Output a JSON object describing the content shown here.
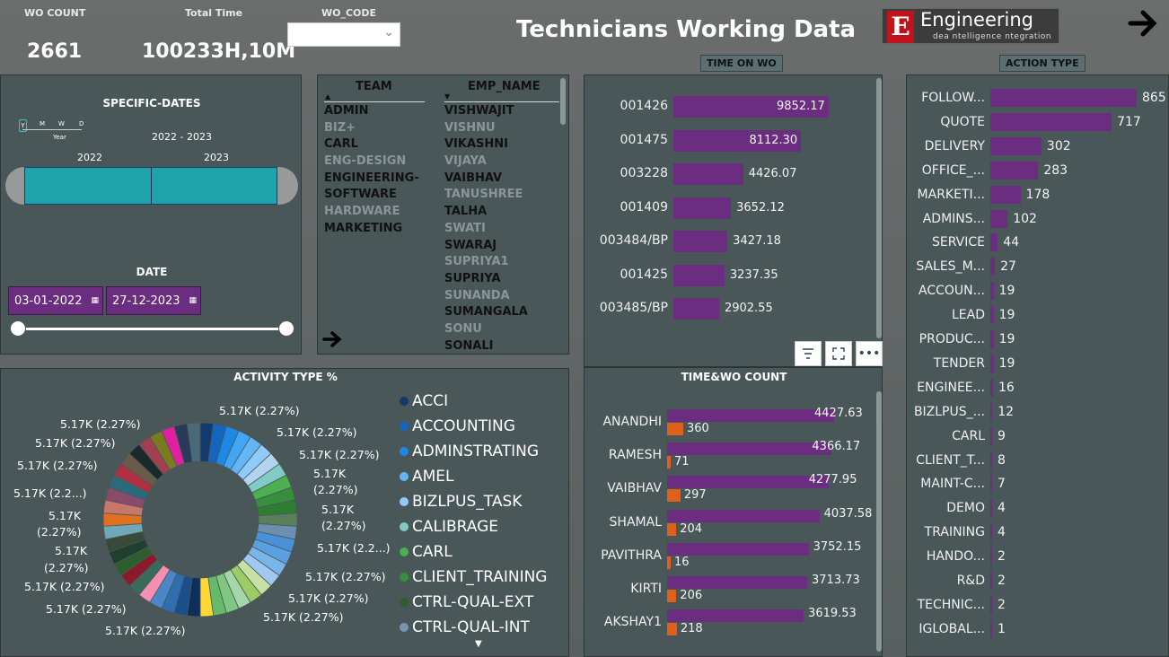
{
  "kpis": {
    "wo_count_label": "WO COUNT",
    "wo_count_value": "2661",
    "total_time_label": "Total Time",
    "total_time_value": "100233H,10M",
    "wo_code_label": "WO_CODE",
    "wo_code_selected": ""
  },
  "header": {
    "title": "Technicians Working Data",
    "logo_text": "Engineering",
    "logo_letter": "E",
    "logo_sub": "dea ntelligence ntegration",
    "next_icon": "arrow-right-icon"
  },
  "dates": {
    "title": "SPECIFIC-DATES",
    "granularity": [
      "Y",
      "M",
      "W",
      "D"
    ],
    "granularity_label": "Year",
    "range_label": "2022 - 2023",
    "years": [
      "2022",
      "2023"
    ],
    "date_title": "DATE",
    "start_date": "03-01-2022",
    "end_date": "27-12-2023",
    "accent": "#1fa3ad"
  },
  "slicer": {
    "team_header": "TEAM",
    "emp_header": "EMP_NAME",
    "teams": [
      {
        "name": "ADMIN",
        "style": "strong"
      },
      {
        "name": "BIZ+",
        "style": "dim"
      },
      {
        "name": "CARL",
        "style": "strong"
      },
      {
        "name": "ENG-DESIGN",
        "style": "dim"
      },
      {
        "name": "ENGINEERING-",
        "style": "strong"
      },
      {
        "name": "SOFTWARE",
        "style": "strong"
      },
      {
        "name": "HARDWARE",
        "style": "dim"
      },
      {
        "name": "MARKETING",
        "style": "strong"
      }
    ],
    "employees": [
      {
        "name": "VISHWAJIT",
        "style": "strong"
      },
      {
        "name": "VISHNU",
        "style": "dim"
      },
      {
        "name": "VIKASHNI",
        "style": "strong"
      },
      {
        "name": "VIJAYA",
        "style": "dim"
      },
      {
        "name": "VAIBHAV",
        "style": "strong"
      },
      {
        "name": "TANUSHREE",
        "style": "dim"
      },
      {
        "name": "TALHA",
        "style": "strong"
      },
      {
        "name": "SWATI",
        "style": "dim"
      },
      {
        "name": "SWARAJ",
        "style": "strong"
      },
      {
        "name": "SUPRIYA1",
        "style": "dim"
      },
      {
        "name": "SUPRIYA",
        "style": "strong"
      },
      {
        "name": "SUNANDA",
        "style": "dim"
      },
      {
        "name": "SUMANGALA",
        "style": "strong"
      },
      {
        "name": "SONU",
        "style": "dim"
      },
      {
        "name": "SONALI",
        "style": "strong"
      }
    ]
  },
  "time_on_wo": {
    "title": "TIME ON WO",
    "bar_color": "#6b2d7f",
    "items": [
      {
        "label": "001426",
        "value": 9852.17,
        "display": "9852.17"
      },
      {
        "label": "001475",
        "value": 8112.3,
        "display": "8112.30"
      },
      {
        "label": "003228",
        "value": 4426.07,
        "display": "4426.07"
      },
      {
        "label": "001409",
        "value": 3652.12,
        "display": "3652.12"
      },
      {
        "label": "003484/BP",
        "value": 3427.18,
        "display": "3427.18"
      },
      {
        "label": "001425",
        "value": 3237.35,
        "display": "3237.35"
      },
      {
        "label": "003485/BP",
        "value": 2902.55,
        "display": "2902.55"
      }
    ],
    "tool_icons": [
      "filter-icon",
      "focus-mode-icon",
      "more-options-icon"
    ]
  },
  "time_wo_count": {
    "title": "TIME&WO COUNT",
    "time_color": "#6b2d7f",
    "count_color": "#e0601a",
    "items": [
      {
        "label": "ANANDHI",
        "time": 4427.63,
        "time_display": "4427.63",
        "count": 360,
        "count_display": "360"
      },
      {
        "label": "RAMESH",
        "time": 4366.17,
        "time_display": "4366.17",
        "count": 71,
        "count_display": "71"
      },
      {
        "label": "VAIBHAV",
        "time": 4277.95,
        "time_display": "4277.95",
        "count": 297,
        "count_display": "297"
      },
      {
        "label": "SHAMAL",
        "time": 4037.58,
        "time_display": "4037.58",
        "count": 204,
        "count_display": "204"
      },
      {
        "label": "PAVITHRA",
        "time": 3752.15,
        "time_display": "3752.15",
        "count": 16,
        "count_display": "16"
      },
      {
        "label": "KIRTI",
        "time": 3713.73,
        "time_display": "3713.73",
        "count": 206,
        "count_display": "206"
      },
      {
        "label": "AKSHAY1",
        "time": 3619.53,
        "time_display": "3619.53",
        "count": 218,
        "count_display": "218"
      }
    ]
  },
  "action_type": {
    "title": "ACTION TYPE",
    "bar_color": "#6b2d7f",
    "items": [
      {
        "label": "FOLLOW...",
        "value": 865
      },
      {
        "label": "QUOTE",
        "value": 717
      },
      {
        "label": "DELIVERY",
        "value": 302
      },
      {
        "label": "OFFICE_...",
        "value": 283
      },
      {
        "label": "MARKETI...",
        "value": 178
      },
      {
        "label": "ADMINS...",
        "value": 102
      },
      {
        "label": "SERVICE",
        "value": 44
      },
      {
        "label": "SALES_M...",
        "value": 27
      },
      {
        "label": "ACCOUN...",
        "value": 19
      },
      {
        "label": "LEAD",
        "value": 19
      },
      {
        "label": "PRODUC...",
        "value": 19
      },
      {
        "label": "TENDER",
        "value": 19
      },
      {
        "label": "ENGINEE...",
        "value": 16
      },
      {
        "label": "BIZLPUS_...",
        "value": 12
      },
      {
        "label": "CARL",
        "value": 9
      },
      {
        "label": "CLIENT_T...",
        "value": 8
      },
      {
        "label": "MAINT-C...",
        "value": 7
      },
      {
        "label": "DEMO",
        "value": 4
      },
      {
        "label": "TRAINING",
        "value": 4
      },
      {
        "label": "HANDO...",
        "value": 2
      },
      {
        "label": "R&D",
        "value": 2
      },
      {
        "label": "TECHNIC...",
        "value": 2
      },
      {
        "label": "IGLOBAL...",
        "value": 1
      }
    ]
  },
  "activity_type": {
    "title": "ACTIVITY TYPE %",
    "legend": [
      {
        "name": "ACCI",
        "color": "#123a6b"
      },
      {
        "name": "ACCOUNTING",
        "color": "#1565c0"
      },
      {
        "name": "ADMINSTRATING",
        "color": "#1e88e5"
      },
      {
        "name": "AMEL",
        "color": "#64b5f6"
      },
      {
        "name": "BIZLPUS_TASK",
        "color": "#90caf9"
      },
      {
        "name": "CALIBRAGE",
        "color": "#80cbc4"
      },
      {
        "name": "CARL",
        "color": "#4caf50"
      },
      {
        "name": "CLIENT_TRAINING",
        "color": "#388e3c"
      },
      {
        "name": "CTRL-QUAL-EXT",
        "color": "#2e5e2e"
      },
      {
        "name": "CTRL-QUAL-INT",
        "color": "#7893b4"
      }
    ],
    "slice_colors": [
      "#123a6b",
      "#1565c0",
      "#1e88e5",
      "#42a5f5",
      "#64b5f6",
      "#90caf9",
      "#b3d4f0",
      "#80cbc4",
      "#4caf50",
      "#388e3c",
      "#2e7d32",
      "#5a7f5a",
      "#6a8faf",
      "#4a90d9",
      "#5aa0e0",
      "#7ab5e8",
      "#a0c8f0",
      "#c5e1a5",
      "#9ccc65",
      "#a5d6a7",
      "#81c784",
      "#66bb6a",
      "#fdd835",
      "#0d2f5a",
      "#1a4f8a",
      "#2f6fb0",
      "#4a86c8",
      "#f48fb1",
      "#3a6a5a",
      "#8b1a2a",
      "#2e5e2e",
      "#1f3f2f",
      "#3a4a3a",
      "#6fa8b8",
      "#e07020",
      "#c8786a",
      "#8a4a6a",
      "#2a6a7a",
      "#b03040",
      "#6a5a4a",
      "#1a2a2a",
      "#a04050",
      "#7a7a20",
      "#e020a0",
      "#2a3a5a",
      "#4a6a7a"
    ],
    "center_color": "#4a5759",
    "labels": [
      "5.17K (2.27%)",
      "5.17K (2.27%)",
      "5.17K (2.27%)",
      "5.17K (2.27%)",
      "5.17K",
      "(2.27%)",
      "5.17K",
      "(2.27%)",
      "5.17K (2.2...)",
      "5.17K (2.27%)",
      "5.17K (2.27%)",
      "5.17K (2.27%)",
      "5.17K (2.27%)",
      "5.17K (2.27%)",
      "5.17K (2.27%)",
      "5.17K (2.27%)",
      "5.17K",
      "(2.27%)",
      "5.17K",
      "(2.27%)",
      "5.17K (2.2...)",
      "5.17K (2.27%)",
      "5.17K (2.27%)",
      "5.17K (2.27%)"
    ]
  }
}
